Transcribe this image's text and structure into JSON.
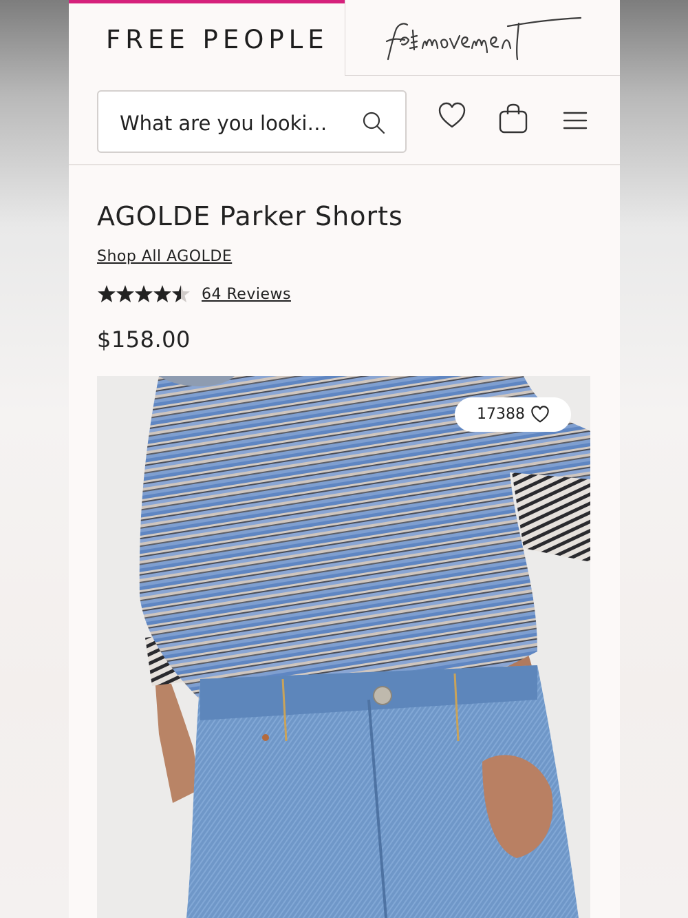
{
  "header": {
    "brand_logo": "FREE PEOPLE",
    "movement_logo": "fpmovement",
    "search": {
      "placeholder": "What are you looki…"
    },
    "icons": [
      "search-icon",
      "heart-icon",
      "bag-icon",
      "menu-icon"
    ]
  },
  "product": {
    "title": "AGOLDE Parker Shorts",
    "brand_link": "Shop All AGOLDE",
    "rating": 4.5,
    "reviews_label": "64 Reviews",
    "price": "$158.00",
    "favorites_count": "17388"
  },
  "colors": {
    "accent": "#d6217c",
    "background": "#fcf9f8",
    "text": "#222222"
  }
}
